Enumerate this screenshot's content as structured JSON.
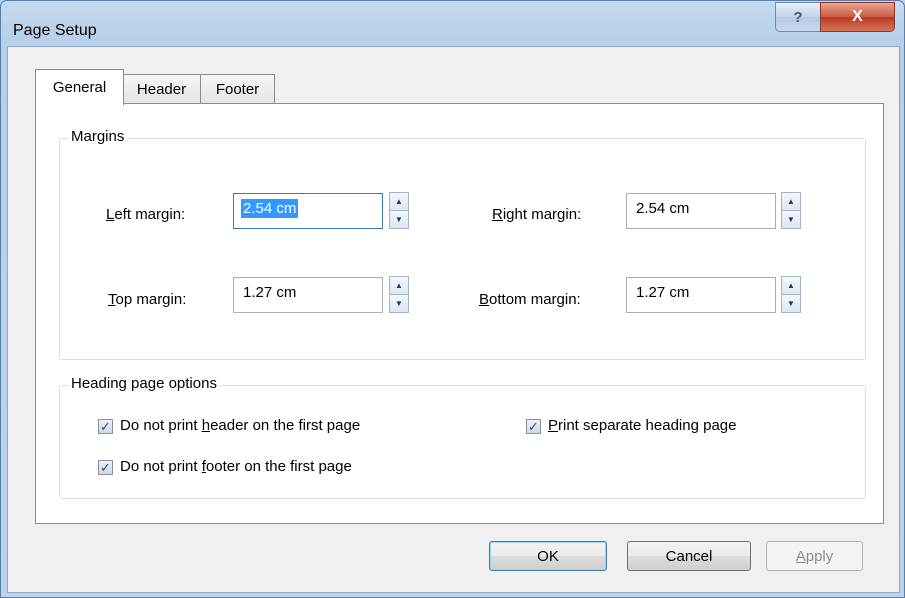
{
  "window": {
    "title": "Page Setup",
    "help_glyph": "?",
    "close_glyph": "X"
  },
  "tabs": [
    {
      "label": "General"
    },
    {
      "label": "Header"
    },
    {
      "label": "Footer"
    }
  ],
  "margins": {
    "group_label": "Margins",
    "left": {
      "mnemonic": "L",
      "rest": "eft margin:",
      "value": "2.54 cm"
    },
    "right": {
      "mnemonic": "R",
      "rest": "ight margin:",
      "value": "2.54 cm"
    },
    "top": {
      "mnemonic": "T",
      "rest": "op margin:",
      "value": "1.27 cm"
    },
    "bottom": {
      "mnemonic": "B",
      "rest": "ottom margin:",
      "value": "1.27 cm"
    }
  },
  "heading_options": {
    "group_label": "Heading page options",
    "no_header": {
      "pre": "Do not print ",
      "mnemonic": "h",
      "post": "eader on the first page",
      "checked": true
    },
    "no_footer": {
      "pre": "Do not print ",
      "mnemonic": "f",
      "post": "ooter on the first page",
      "checked": true
    },
    "separate": {
      "pre": "",
      "mnemonic": "P",
      "post": "rint separate heading page",
      "checked": true
    }
  },
  "buttons": {
    "ok": "OK",
    "cancel": "Cancel",
    "apply_mnemonic": "A",
    "apply_rest": "pply"
  },
  "icons": {
    "check": "✓",
    "up": "▲",
    "down": "▼"
  }
}
